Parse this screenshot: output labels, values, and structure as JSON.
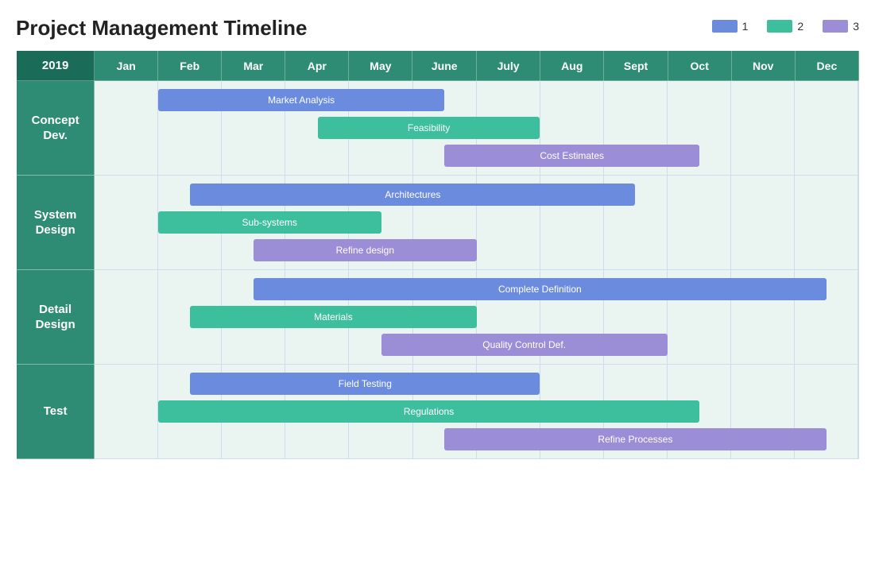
{
  "title": "Project Management Timeline",
  "legend": {
    "items": [
      {
        "id": 1,
        "label": "1",
        "color": "#6b8cde"
      },
      {
        "id": 2,
        "label": "2",
        "color": "#3dbf9e"
      },
      {
        "id": 3,
        "label": "3",
        "color": "#9b8ed6"
      }
    ]
  },
  "year": "2019",
  "months": [
    "Jan",
    "Feb",
    "Mar",
    "Apr",
    "May",
    "June",
    "July",
    "Aug",
    "Sept",
    "Oct",
    "Nov",
    "Dec"
  ],
  "sections": [
    {
      "id": "concept-dev",
      "label": "Concept\nDev.",
      "bars": [
        {
          "label": "Market Analysis",
          "color": "#6b8cde",
          "start": 0.083,
          "end": 0.458
        },
        {
          "label": "Feasibility",
          "color": "#3dbf9e",
          "start": 0.292,
          "end": 0.583
        },
        {
          "label": "Cost Estimates",
          "color": "#9b8ed6",
          "start": 0.458,
          "end": 0.792
        }
      ]
    },
    {
      "id": "system-design",
      "label": "System\nDesign",
      "bars": [
        {
          "label": "Architectures",
          "color": "#6b8cde",
          "start": 0.125,
          "end": 0.708
        },
        {
          "label": "Sub-systems",
          "color": "#3dbf9e",
          "start": 0.083,
          "end": 0.375
        },
        {
          "label": "Refine design",
          "color": "#9b8ed6",
          "start": 0.208,
          "end": 0.5
        }
      ]
    },
    {
      "id": "detail-design",
      "label": "Detail\nDesign",
      "bars": [
        {
          "label": "Complete Definition",
          "color": "#6b8cde",
          "start": 0.208,
          "end": 0.958
        },
        {
          "label": "Materials",
          "color": "#3dbf9e",
          "start": 0.125,
          "end": 0.5
        },
        {
          "label": "Quality Control Def.",
          "color": "#9b8ed6",
          "start": 0.375,
          "end": 0.75
        }
      ]
    },
    {
      "id": "test",
      "label": "Test",
      "bars": [
        {
          "label": "Field Testing",
          "color": "#6b8cde",
          "start": 0.125,
          "end": 0.583
        },
        {
          "label": "Regulations",
          "color": "#3dbf9e",
          "start": 0.083,
          "end": 0.792
        },
        {
          "label": "Refine Processes",
          "color": "#9b8ed6",
          "start": 0.458,
          "end": 0.958
        }
      ]
    }
  ],
  "colors": {
    "header_bg": "#2e8b74",
    "year_bg": "#1a6b58",
    "section_bg": "#eaf5f2",
    "grid_line": "#cde"
  }
}
